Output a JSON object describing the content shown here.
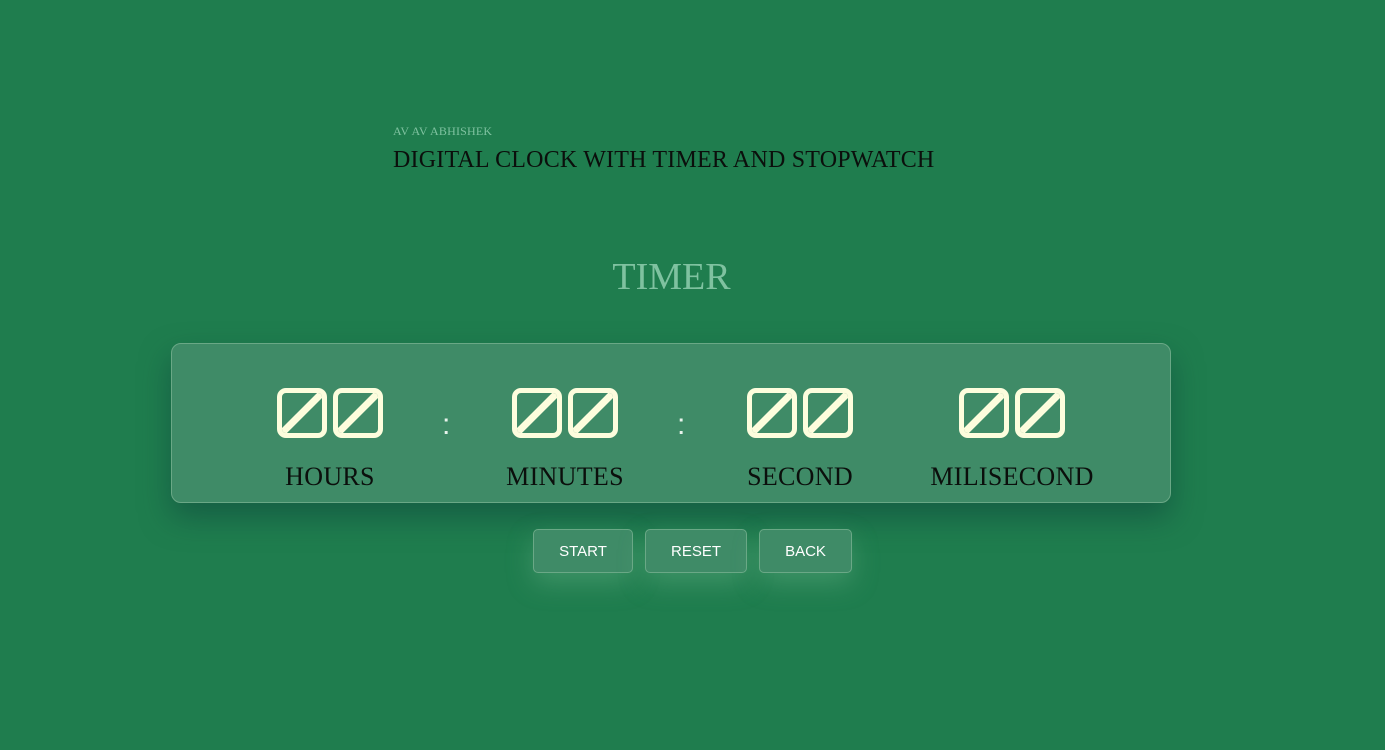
{
  "header": {
    "author": "AV AV ABHISHEK",
    "headline": "DIGITAL CLOCK WITH TIMER AND STOPWATCH"
  },
  "section_title": "TIMER",
  "timer": {
    "separator": ":",
    "units": [
      {
        "label": "HOURS",
        "value": "00"
      },
      {
        "label": "MINUTES",
        "value": "00"
      },
      {
        "label": "SECOND",
        "value": "00"
      },
      {
        "label": "MILISECOND",
        "value": "00"
      }
    ]
  },
  "buttons": {
    "start": "START",
    "reset": "RESET",
    "back": "BACK"
  },
  "colors": {
    "background": "#1f7d4e",
    "panel": "#3f8b67",
    "digit": "#fdfddd",
    "title": "#7fc2a0"
  }
}
